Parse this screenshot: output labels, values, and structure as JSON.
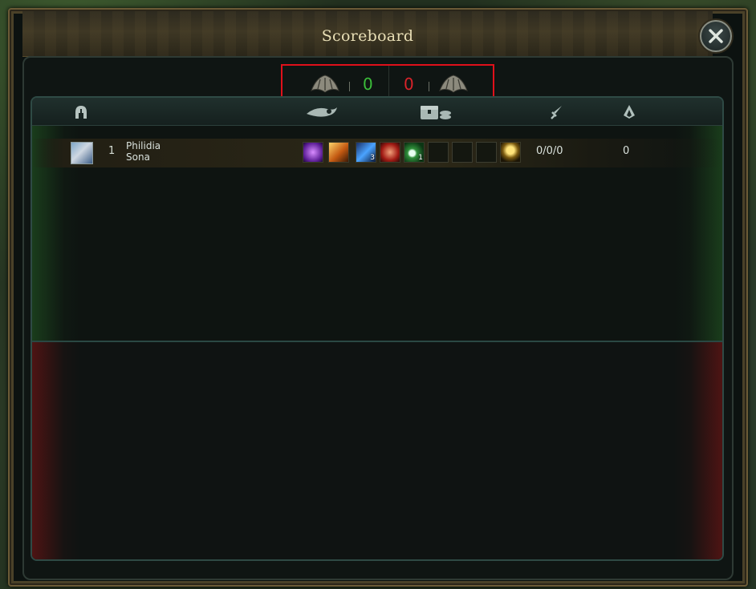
{
  "window": {
    "title": "Scoreboard"
  },
  "score": {
    "blue_kills": "0",
    "red_kills": "0"
  },
  "header": {
    "icons": [
      "helmet-icon",
      "summoner-spell-icon",
      "items-gold-icon",
      "kda-sword-icon",
      "minion-icon"
    ]
  },
  "players": [
    {
      "level": "1",
      "name": "Philidia",
      "champion": "Sona",
      "items": [
        {
          "icon": "purple-orb-item-icon",
          "count": ""
        },
        {
          "icon": "orange-flame-item-icon",
          "count": ""
        },
        {
          "icon": "blue-potion-item-icon",
          "count": "3"
        },
        {
          "icon": "red-potion-item-icon",
          "count": ""
        },
        {
          "icon": "green-ward-item-icon",
          "count": "1"
        },
        {
          "icon": "empty-slot-icon",
          "count": ""
        },
        {
          "icon": "empty-slot-icon",
          "count": ""
        },
        {
          "icon": "empty-slot-icon",
          "count": ""
        },
        {
          "icon": "trinket-icon",
          "count": ""
        }
      ],
      "kda": "0/0/0",
      "cs": "0"
    }
  ],
  "colors": {
    "blue_team": "#3bbd3a",
    "red_team": "#d8232a",
    "highlight_box": "#e0101a"
  }
}
